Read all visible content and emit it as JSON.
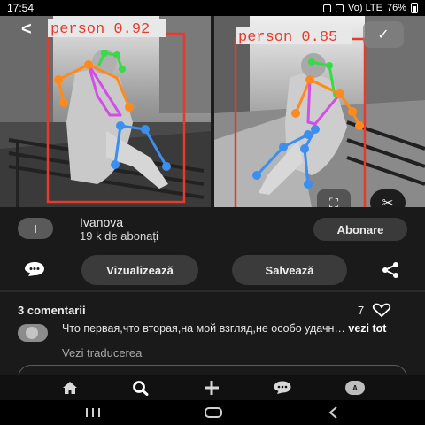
{
  "status_bar": {
    "time": "17:54",
    "battery": "76%",
    "network": "Vo) LTE"
  },
  "detections": [
    {
      "label": "person 0.92"
    },
    {
      "label": "person 0.85"
    }
  ],
  "colors": {
    "box": "#e53b2c",
    "label_text": "#e53b2c",
    "skeleton_head": "#39d94a",
    "skeleton_arms": "#ff8a1c",
    "skeleton_torso": "#d24ee6",
    "skeleton_legs": "#3a8ff0",
    "accent_dark": "#1a1a1a"
  },
  "profile": {
    "avatar_initial": "I",
    "name": "Ivanova",
    "followers": "19 k de abonați",
    "follow_label": "Abonare"
  },
  "actions": {
    "visit_label": "Vizualizează",
    "save_label": "Salvează"
  },
  "comments": {
    "title": "3 comentarii",
    "likes": "7",
    "first_comment": "Что первая,что вторая,на мой взгляд,не особо удачн…",
    "more_label": "vezi tot",
    "translate_label": "Vezi traducerea"
  },
  "icons": {
    "back": "chevron-left-icon",
    "fab": "check-icon",
    "crop": "crop-icon",
    "scissors": "scissors-icon",
    "comment": "speech-bubble-icon",
    "share": "share-icon",
    "heart": "heart-icon",
    "nav_home": "home-icon",
    "nav_search": "search-icon",
    "nav_add": "plus-icon",
    "nav_messages": "messages-icon",
    "nav_profile": "profile-icon"
  }
}
